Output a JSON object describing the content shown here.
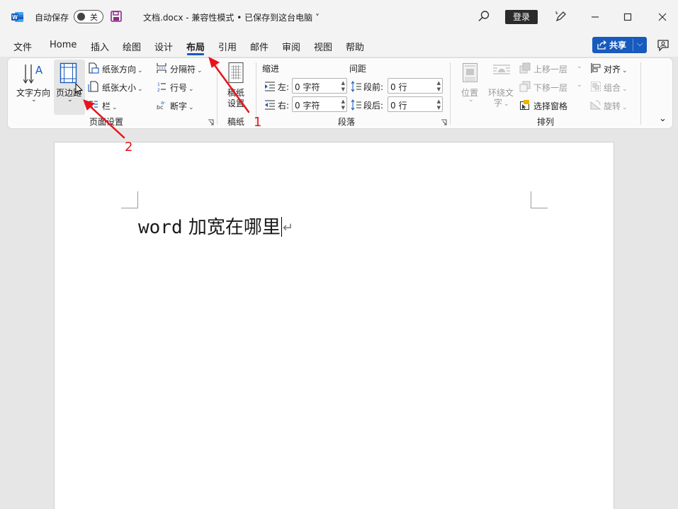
{
  "titlebar": {
    "autosave_label": "自动保存",
    "toggle_state": "关",
    "doc_title": "文档.docx  -  兼容性模式 • 已保存到这台电脑 ˅",
    "login_label": "登录"
  },
  "tabs": [
    {
      "label": "文件"
    },
    {
      "label": "Home"
    },
    {
      "label": "插入"
    },
    {
      "label": "绘图"
    },
    {
      "label": "设计"
    },
    {
      "label": "布局"
    },
    {
      "label": "引用"
    },
    {
      "label": "邮件"
    },
    {
      "label": "审阅"
    },
    {
      "label": "视图"
    },
    {
      "label": "帮助"
    }
  ],
  "share": {
    "label": "共享"
  },
  "ribbon": {
    "page_setup": {
      "text_direction": "文字方向",
      "margins": "页边距",
      "orientation": "纸张方向",
      "size": "纸张大小",
      "columns": "栏",
      "breaks": "分隔符",
      "line_numbers": "行号",
      "hyphenation": "断字",
      "group_label": "页面设置"
    },
    "manuscript": {
      "button_line1": "稿纸",
      "button_line2": "设置",
      "group_label": "稿纸"
    },
    "paragraph": {
      "indent_header": "缩进",
      "spacing_header": "间距",
      "left_label": "左:",
      "right_label": "右:",
      "before_label": "段前:",
      "after_label": "段后:",
      "left_value": "0 字符",
      "right_value": "0 字符",
      "before_value": "0 行",
      "after_value": "0 行",
      "group_label": "段落"
    },
    "arrange": {
      "position": "位置",
      "wrap_line1": "环绕文",
      "wrap_line2": "字",
      "bring_forward": "上移一层",
      "send_backward": "下移一层",
      "selection_pane": "选择窗格",
      "align": "对齐",
      "group": "组合",
      "rotate": "旋转",
      "group_label": "排列"
    }
  },
  "document": {
    "text_latin": "word",
    "text_cjk": " 加宽在哪里"
  },
  "annotations": {
    "one": "1",
    "two": "2"
  },
  "colors": {
    "accent": "#185abd",
    "annotation": "#e8131c"
  }
}
